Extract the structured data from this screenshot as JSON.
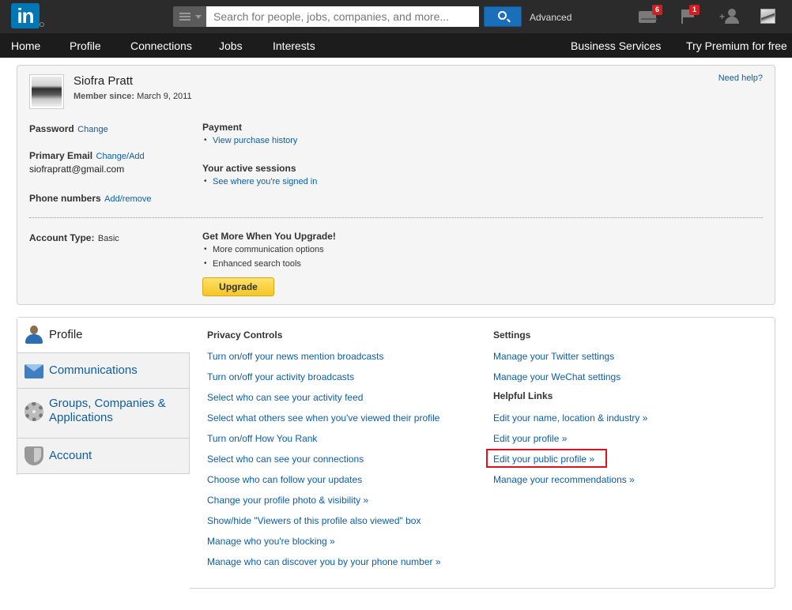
{
  "header": {
    "logo_text": "in",
    "search_placeholder": "Search for people, jobs, companies, and more...",
    "advanced_label": "Advanced",
    "messages_count": "6",
    "notifications_count": "1"
  },
  "nav": {
    "home": "Home",
    "profile": "Profile",
    "connections": "Connections",
    "jobs": "Jobs",
    "interests": "Interests",
    "business": "Business Services",
    "premium": "Try Premium for free"
  },
  "account": {
    "name": "Siofra Pratt",
    "member_since_label": "Member since:",
    "member_since_value": "March 9, 2011",
    "need_help": "Need help?",
    "password_label": "Password",
    "password_link": "Change",
    "email_label": "Primary Email",
    "email_link": "Change/Add",
    "email_value": "siofrapratt@gmail.com",
    "phone_label": "Phone numbers",
    "phone_link": "Add/remove",
    "payment_label": "Payment",
    "payment_link": "View purchase history",
    "sessions_label": "Your active sessions",
    "sessions_link": "See where you're signed in",
    "account_type_label": "Account Type:",
    "account_type_value": "Basic",
    "upgrade_heading": "Get More When You Upgrade!",
    "upgrade_items": [
      "More communication options",
      "Enhanced search tools"
    ],
    "upgrade_button": "Upgrade"
  },
  "tabs": {
    "profile": "Profile",
    "communications": "Communications",
    "groups": "Groups, Companies & Applications",
    "account": "Account"
  },
  "privacy": {
    "heading": "Privacy Controls",
    "links": [
      "Turn on/off your news mention broadcasts",
      "Turn on/off your activity broadcasts",
      "Select who can see your activity feed",
      "Select what others see when you've viewed their profile",
      "Turn on/off How You Rank",
      "Select who can see your connections",
      "Choose who can follow your updates",
      "Change your profile photo & visibility »",
      "Show/hide \"Viewers of this profile also viewed\" box",
      "Manage who you're blocking »",
      "Manage who can discover you by your phone number »"
    ]
  },
  "settings": {
    "heading": "Settings",
    "links": [
      "Manage your Twitter settings",
      "Manage your WeChat settings"
    ],
    "helpful_heading": "Helpful Links",
    "helpful_links": [
      "Edit your name, location & industry »",
      "Edit your profile »",
      "Edit your public profile »",
      "Manage your recommendations »"
    ]
  }
}
